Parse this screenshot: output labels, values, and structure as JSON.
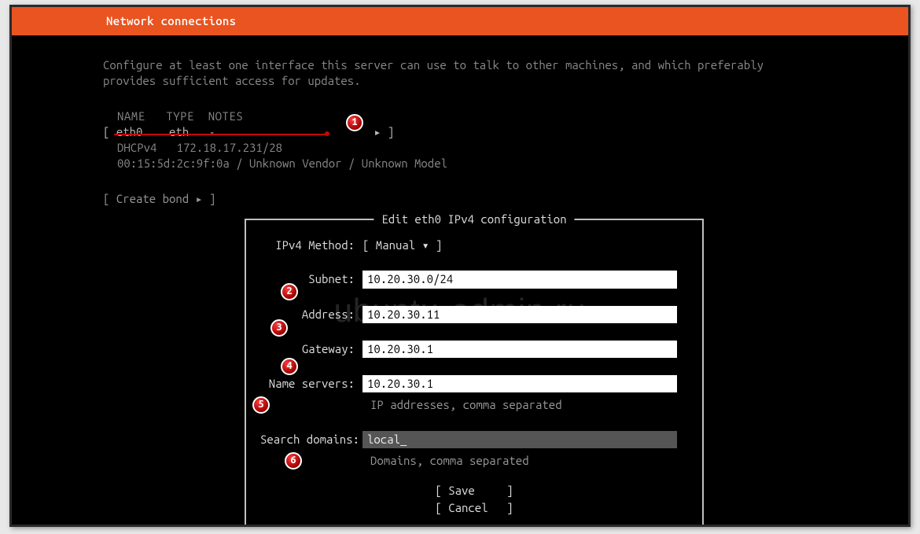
{
  "header": {
    "title": "Network connections"
  },
  "intro": "Configure at least one interface this server can use to talk to other machines, and which preferably provides sufficient access for updates.",
  "iface": {
    "headers": {
      "name": "NAME",
      "type": "TYPE",
      "notes": "NOTES"
    },
    "row": {
      "name": "eth0",
      "type": "eth",
      "notes": "-",
      "arrow": "▸"
    },
    "dhcp_label": "DHCPv4",
    "dhcp_value": "172.18.17.231/28",
    "mac_line": "00:15:5d:2c:9f:0a / Unknown Vendor / Unknown Model"
  },
  "create_bond": "[ Create bond ▸ ]",
  "dialog": {
    "legend": "Edit eth0 IPv4 configuration",
    "method_label": "IPv4 Method:",
    "method_value": "[ Manual           ▾ ]",
    "subnet_label": "Subnet:",
    "subnet_value": "10.20.30.0/24",
    "address_label": "Address:",
    "address_value": "10.20.30.11",
    "gateway_label": "Gateway:",
    "gateway_value": "10.20.30.1",
    "ns_label": "Name servers:",
    "ns_value": "10.20.30.1",
    "ns_hint": "IP addresses, comma separated",
    "sd_label": "Search domains:",
    "sd_value": "local_",
    "sd_hint": "Domains, comma separated",
    "save": "Save",
    "cancel": "Cancel"
  },
  "callouts": {
    "c1": "1",
    "c2": "2",
    "c3": "3",
    "c4": "4",
    "c5": "5",
    "c6": "6"
  },
  "watermark": "ubuntu-admin.ru"
}
